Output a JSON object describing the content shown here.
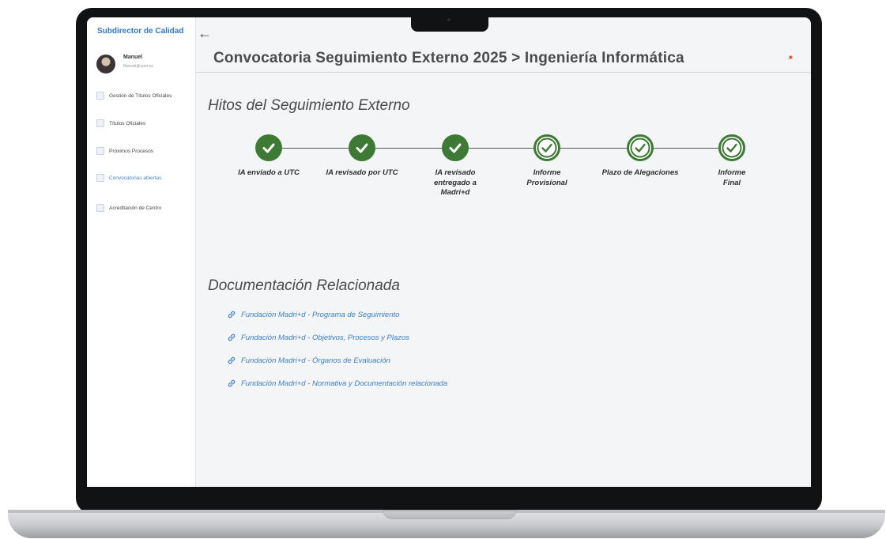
{
  "sidebar": {
    "title": "Subdirector de Calidad",
    "user": {
      "name": "Manuel",
      "email": "Manuel@upm.es"
    },
    "items": [
      {
        "label": "Gestión de Títulos Oficiales"
      },
      {
        "label": "Títulos Oficiales"
      },
      {
        "label": "Próximos Procesos"
      },
      {
        "label": "Convocatorias abiertas"
      },
      {
        "label": "Acreditación de Centro"
      }
    ]
  },
  "header": {
    "back_icon": "arrow-left-icon",
    "title": "Convocatoria Seguimiento Externo 2025 > Ingeniería Informática",
    "notification_color": "#e74c3c"
  },
  "milestones": {
    "title": "Hitos del Seguimiento Externo",
    "accent": "#3d7a33",
    "items": [
      {
        "label": "IA enviado a UTC",
        "status": "done"
      },
      {
        "label": "IA revisado por  UTC",
        "status": "done"
      },
      {
        "label": "IA revisado entregado a Madri+d",
        "status": "done"
      },
      {
        "label": "Informe Provisional",
        "status": "pending"
      },
      {
        "label": "Plazo de Alegaciones",
        "status": "pending"
      },
      {
        "label": "Informe Final",
        "status": "pending"
      }
    ]
  },
  "documentation": {
    "title": "Documentación Relacionada",
    "link_icon": "link-icon",
    "links": [
      {
        "label": "Fundación Madri+d - Programa de Seguimiento"
      },
      {
        "label": "Fundación Madri+d - Objetivos, Procesos y Plazos"
      },
      {
        "label": "Fundación Madri+d - Órganos de Evaluación"
      },
      {
        "label": "Fundación Madri+d - Normativa y Documentación relacionada"
      }
    ]
  }
}
